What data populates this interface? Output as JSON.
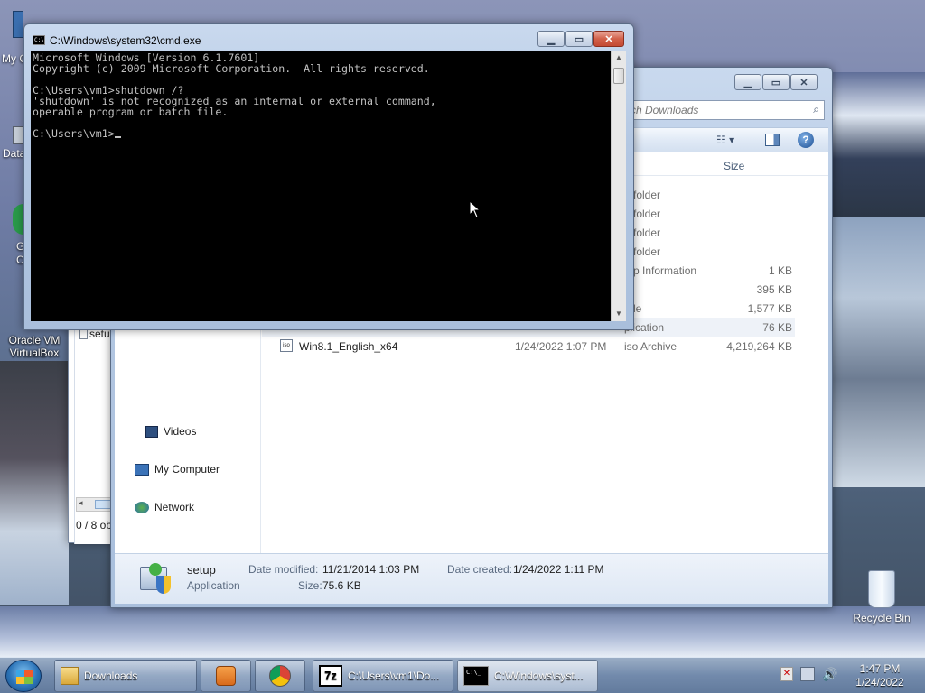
{
  "desktop": {
    "icons": [
      {
        "label": "My C",
        "kind": "computer-icon"
      },
      {
        "label": "Data",
        "kind": "disk-icon"
      },
      {
        "label": "G C",
        "kind": "chrome-icon"
      },
      {
        "label": "Oracle VM VirtualBox",
        "kind": "virtualbox-icon"
      }
    ],
    "recycle_bin": "Recycle Bin"
  },
  "cmd": {
    "title": "C:\\Windows\\system32\\cmd.exe",
    "lines": [
      "Microsoft Windows [Version 6.1.7601]",
      "Copyright (c) 2009 Microsoft Corporation.  All rights reserved.",
      "",
      "C:\\Users\\vm1>shutdown /?",
      "'shutdown' is not recognized as an internal or external command,",
      "operable program or batch file.",
      "",
      "C:\\Users\\vm1>"
    ]
  },
  "explorer": {
    "search_placeholder": "ch Downloads",
    "columns": {
      "type": "pe",
      "size": "Size"
    },
    "nav": [
      {
        "label": "Videos",
        "icon": "videos-icon"
      },
      {
        "label": "My Computer",
        "icon": "computer-icon"
      },
      {
        "label": "Network",
        "icon": "network-icon"
      }
    ],
    "rows": [
      {
        "name": "",
        "date": "",
        "type": "e folder",
        "size": ""
      },
      {
        "name": "",
        "date": "",
        "type": "e folder",
        "size": ""
      },
      {
        "name": "",
        "date": "",
        "type": "e folder",
        "size": ""
      },
      {
        "name": "",
        "date": "",
        "type": "e folder",
        "size": ""
      },
      {
        "name": "",
        "date": "",
        "type": "tup Information",
        "size": "1 KB"
      },
      {
        "name": "",
        "date": "",
        "type": "e",
        "size": "395 KB"
      },
      {
        "name": "",
        "date": "",
        "type": "File",
        "size": "1,577 KB"
      },
      {
        "name": "",
        "date": "",
        "type": "plication",
        "size": "76 KB"
      },
      {
        "name": "Win8.1_English_x64",
        "date": "1/24/2022 1:07 PM",
        "type": "iso Archive",
        "size": "4,219,264 KB"
      }
    ],
    "details": {
      "name": "setup",
      "kind": "Application",
      "date_modified_label": "Date modified:",
      "date_modified": "11/21/2014 1:03 PM",
      "date_created_label": "Date created:",
      "date_created": "1/24/2022 1:11 PM",
      "size_label": "Size:",
      "size": "75.6 KB"
    }
  },
  "back_window": {
    "partial_item": "setu",
    "status": "0 / 8 ob"
  },
  "taskbar": {
    "buttons": [
      {
        "label": "Downloads",
        "icon": "folder-icon"
      },
      {
        "label": "",
        "icon": "media-player-icon"
      },
      {
        "label": "",
        "icon": "chrome-icon"
      },
      {
        "label": "C:\\Users\\vm1\\Do...",
        "icon": "7zip-icon"
      },
      {
        "label": "C:\\Windows\\syst...",
        "icon": "cmd-icon"
      }
    ],
    "time": "1:47 PM",
    "date": "1/24/2022"
  }
}
